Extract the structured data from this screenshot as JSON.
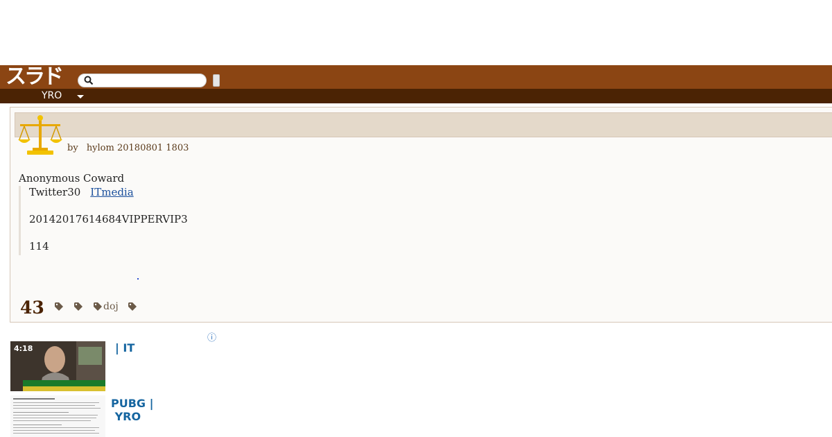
{
  "header": {
    "logo_text": "スラド",
    "search": {
      "placeholder": ""
    }
  },
  "nav": {
    "section_label": "YRO"
  },
  "article": {
    "byline": {
      "by_label": "by",
      "author": "hylom",
      "timestamp": "20180801 1803"
    },
    "poster": "Anonymous Coward",
    "quote": {
      "line1": "Twitter30",
      "link_text": "ITmedia",
      "line2": "20142017614684VIPPERVIP3",
      "line3": "114"
    },
    "comment_count": "43",
    "tags": [
      "",
      "",
      "doj",
      ""
    ]
  },
  "ads": {
    "info_icon": "ⓘ",
    "items": [
      {
        "text_line1": "|  IT",
        "thumb_time": "4:18"
      },
      {
        "text_line1": "PUBG |",
        "text_line2": " YRO"
      }
    ]
  },
  "colors": {
    "header_bg": "#8b4513",
    "subbar_bg": "#4b2304",
    "title_bar": "#e4d9ca",
    "link": "#1b4f9c"
  }
}
